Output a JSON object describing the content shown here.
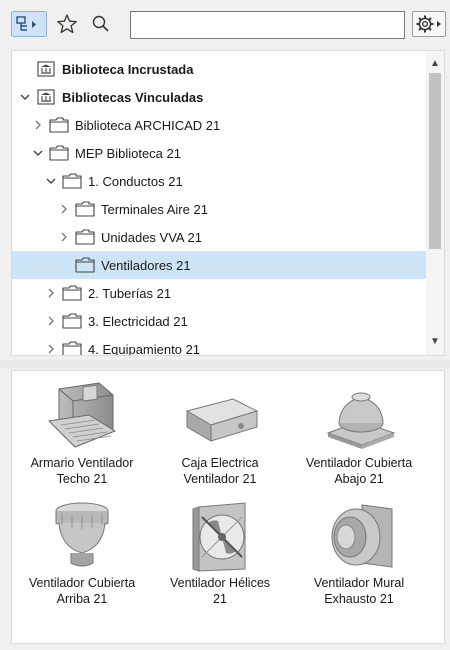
{
  "toolbar": {
    "browse_icon": "browse-tree-icon",
    "favorites_icon": "star-icon",
    "search_icon": "search-icon",
    "search_value": "",
    "options_icon": "gear-icon"
  },
  "tree": {
    "items": [
      {
        "label": "Biblioteca Incrustada",
        "level": 0,
        "expander": "none",
        "icon": "library-icon",
        "bold": true,
        "selected": false
      },
      {
        "label": "Bibliotecas Vinculadas",
        "level": 0,
        "expander": "open",
        "icon": "library-icon",
        "bold": true,
        "selected": false
      },
      {
        "label": "Biblioteca ARCHICAD 21",
        "level": 1,
        "expander": "closed",
        "icon": "folder-icon",
        "bold": false,
        "selected": false
      },
      {
        "label": "MEP Biblioteca 21",
        "level": 1,
        "expander": "open",
        "icon": "folder-icon",
        "bold": false,
        "selected": false
      },
      {
        "label": "1. Conductos 21",
        "level": 2,
        "expander": "open",
        "icon": "folder-icon",
        "bold": false,
        "selected": false
      },
      {
        "label": "Terminales Aire 21",
        "level": 3,
        "expander": "closed",
        "icon": "folder-icon",
        "bold": false,
        "selected": false
      },
      {
        "label": "Unidades VVA 21",
        "level": 3,
        "expander": "closed",
        "icon": "folder-icon",
        "bold": false,
        "selected": false
      },
      {
        "label": "Ventiladores 21",
        "level": 3,
        "expander": "none",
        "icon": "folder-icon",
        "bold": false,
        "selected": true
      },
      {
        "label": "2. Tuberías 21",
        "level": 2,
        "expander": "closed",
        "icon": "folder-icon",
        "bold": false,
        "selected": false
      },
      {
        "label": "3. Electricidad 21",
        "level": 2,
        "expander": "closed",
        "icon": "folder-icon",
        "bold": false,
        "selected": false
      },
      {
        "label": "4. Equipamiento 21",
        "level": 2,
        "expander": "closed",
        "icon": "folder-icon",
        "bold": false,
        "selected": false
      }
    ]
  },
  "objects": [
    {
      "line1": "Armario Ventilador",
      "line2": "Techo 21",
      "icon": "cabinet-fan-icon"
    },
    {
      "line1": "Caja Electrica",
      "line2": "Ventilador 21",
      "icon": "box-fan-icon"
    },
    {
      "line1": "Ventilador Cubierta",
      "line2": "Abajo 21",
      "icon": "roof-fan-down-icon"
    },
    {
      "line1": "Ventilador Cubierta",
      "line2": "Arriba 21",
      "icon": "roof-fan-up-icon"
    },
    {
      "line1": "Ventilador Hélices",
      "line2": "21",
      "icon": "propeller-fan-icon"
    },
    {
      "line1": "Ventilador Mural",
      "line2": "Exhausto 21",
      "icon": "wall-exhaust-fan-icon"
    }
  ],
  "colors": {
    "selection": "#cde4f7",
    "toolbar_active": "#cfe2f7"
  }
}
